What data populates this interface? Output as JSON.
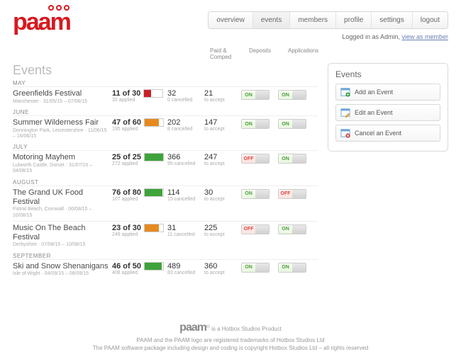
{
  "brand": "paam",
  "nav": {
    "items": [
      {
        "label": "overview"
      },
      {
        "label": "events",
        "active": true
      },
      {
        "label": "members"
      },
      {
        "label": "profile"
      },
      {
        "label": "settings"
      },
      {
        "label": "logout"
      }
    ]
  },
  "login": {
    "prefix": "Logged in as Admin, ",
    "link": "view as member"
  },
  "columns": {
    "paid": "Paid & Comped",
    "deposits": "Deposits",
    "applications": "Applications"
  },
  "page_title": "Events",
  "months": [
    {
      "label": "MAY",
      "events": [
        {
          "name": "Greenfields Festival",
          "meta": "Manchester · 31/05/15 – 07/06/15",
          "count": "11 of 30",
          "applied": "32 applied",
          "fill_pct": 37,
          "fill_color": "#c8202a",
          "paid": "32",
          "paid_sub": "0 cancelled",
          "dep": "21",
          "dep_sub": "to accept",
          "t1": "ON",
          "t2": "ON"
        }
      ]
    },
    {
      "label": "JUNE",
      "events": [
        {
          "name": "Summer Wilderness Fair",
          "meta": "Donnington Park, Leicestershire · 11/06/15 – 16/06/15",
          "count": "47 of 60",
          "applied": "195 applied",
          "fill_pct": 78,
          "fill_color": "#e68a1f",
          "paid": "202",
          "paid_sub": "8 cancelled",
          "dep": "147",
          "dep_sub": "to accept",
          "t1": "ON",
          "t2": "ON"
        }
      ]
    },
    {
      "label": "JULY",
      "events": [
        {
          "name": "Motoring Mayhem",
          "meta": "Lulworth Castle, Dorset · 31/07/15 – 04/08/15",
          "count": "25 of 25",
          "applied": "272 applied",
          "fill_pct": 100,
          "fill_color": "#3da33a",
          "paid": "366",
          "paid_sub": "95 cancelled",
          "dep": "247",
          "dep_sub": "to accept",
          "t1": "OFF",
          "t2": "ON"
        }
      ]
    },
    {
      "label": "AUGUST",
      "events": [
        {
          "name": "The Grand UK Food Festival",
          "meta": "Fistral Beach, Cornwall · 06/08/15 – 10/08/15",
          "count": "76 of 80",
          "applied": "107 applied",
          "fill_pct": 95,
          "fill_color": "#3da33a",
          "paid": "114",
          "paid_sub": "15 cancelled",
          "dep": "30",
          "dep_sub": "to accept",
          "t1": "ON",
          "t2": "OFF"
        },
        {
          "name": "Music On The Beach Festival",
          "meta": "Derbyshire · 07/08/15 – 10/08/15",
          "count": "23 of 30",
          "applied": "249 applied",
          "fill_pct": 77,
          "fill_color": "#e68a1f",
          "paid": "31",
          "paid_sub": "11 cancelled",
          "dep": "225",
          "dep_sub": "to accept",
          "t1": "OFF",
          "t2": "ON"
        }
      ]
    },
    {
      "label": "SEPTEMBER",
      "events": [
        {
          "name": "Ski and Snow Shenanigans",
          "meta": "Isle of Wight · 04/09/15 – 08/09/15",
          "count": "46 of 50",
          "applied": "408 applied",
          "fill_pct": 92,
          "fill_color": "#3da33a",
          "paid": "489",
          "paid_sub": "83 cancelled",
          "dep": "360",
          "dep_sub": "to accept",
          "t1": "ON",
          "t2": "ON"
        }
      ]
    }
  ],
  "side": {
    "title": "Events",
    "add": "Add an Event",
    "edit": "Edit an Event",
    "cancel": "Cancel an Event"
  },
  "footer": {
    "logo": "paam",
    "l1": " is a Hotbox Studios Product",
    "l2": "PAAM and the PAAM logo are registered trademarks of Hotbox Studios Ltd",
    "l3": "The PAAM software package including design and coding is copyright Hotbox Studios Ltd – all rights reserved"
  }
}
